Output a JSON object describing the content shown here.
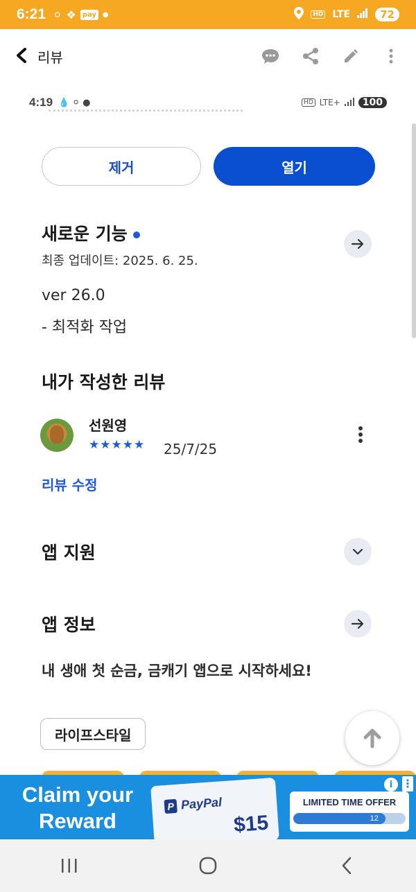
{
  "status_bar": {
    "time": "6:21",
    "pay_label": "pay",
    "hd": "HD",
    "network": "LTE",
    "battery": "72"
  },
  "app_bar": {
    "title": "리뷰"
  },
  "inner_status": {
    "time": "4:19",
    "hd": "HD",
    "network": "LTE+",
    "battery": "100"
  },
  "buttons": {
    "remove": "제거",
    "open": "열기"
  },
  "whats_new": {
    "title": "새로운 기능",
    "last_update": "최종 업데이트: 2025. 6. 25.",
    "version": "ver 26.0",
    "notes": "- 최적화 작업"
  },
  "my_review": {
    "title": "내가 작성한 리뷰",
    "reviewer": "선원영",
    "stars": "★★★★★",
    "rating": 5,
    "date": "25/7/25",
    "edit_label": "리뷰 수정"
  },
  "app_support": {
    "title": "앱 지원"
  },
  "app_info": {
    "title": "앱 정보",
    "description": "내 생애 첫 순금, 금캐기 앱으로 시작하세요!"
  },
  "category_chip": "라이프스타일",
  "ad": {
    "headline": "Claim your Reward",
    "brand": "PayPal",
    "amount": "$15",
    "offer_label": "LIMITED TIME OFFER",
    "progress_value": "12",
    "progress_fraction": 0.82,
    "colors": {
      "background": "#1a8fdf",
      "brand": "#1f3a8a"
    }
  },
  "colors": {
    "accent": "#0b4fd1",
    "status_bar": "#f6a823",
    "link": "#1f5ad8"
  }
}
